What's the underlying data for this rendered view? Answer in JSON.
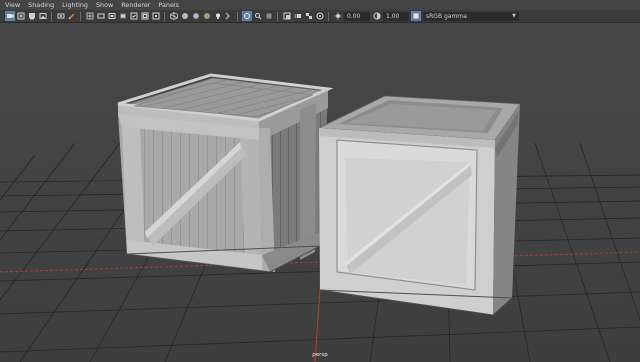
{
  "menubar": {
    "items": [
      "View",
      "Shading",
      "Lighting",
      "Show",
      "Renderer",
      "Panels"
    ]
  },
  "toolbar": {
    "exposure_value": "0.00",
    "gamma_value": "1.00",
    "color_space": "sRGB gamma"
  },
  "viewport": {
    "camera_label": "persp"
  },
  "colors": {
    "background": "#444444",
    "grid_line": "#232323",
    "grid_axis_red": "#b73a3a",
    "crate_light": "#b5b5b5",
    "crate_dark": "#6f6f6f",
    "highlight": "#5d7fa3"
  }
}
